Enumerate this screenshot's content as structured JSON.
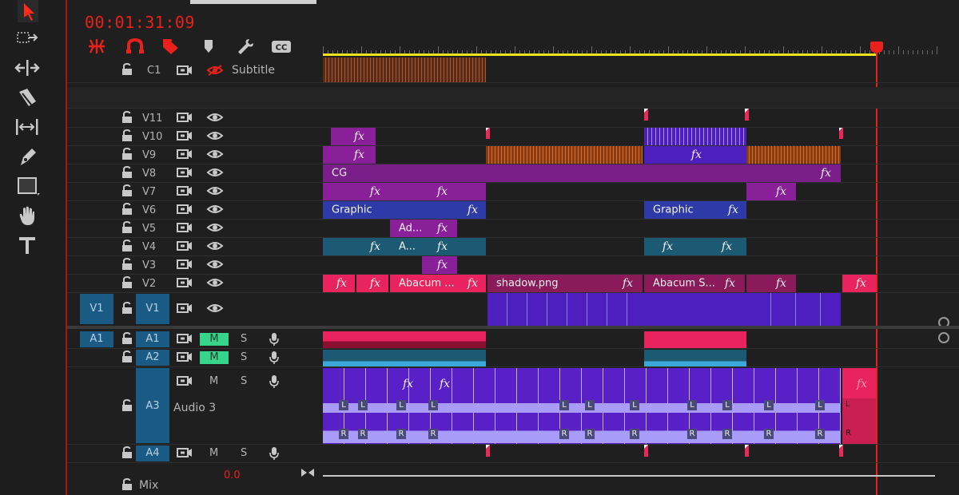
{
  "timecode": "00:01:31:09",
  "tools": [
    "selection-tool",
    "track-select-tool",
    "ripple-edit-tool",
    "razor-tool",
    "slip-tool",
    "pen-tool",
    "rectangle-tool",
    "hand-tool",
    "type-tool"
  ],
  "timeline_controls": [
    "snap-icon",
    "linked-selection-icon",
    "add-marker-icon",
    "marker-icon",
    "settings-wrench-icon",
    "captions-icon"
  ],
  "captions_icon_label": "CC",
  "caption_track": {
    "id": "C1",
    "name": "Subtitle"
  },
  "video_tracks": [
    {
      "id": "V11"
    },
    {
      "id": "V10"
    },
    {
      "id": "V9"
    },
    {
      "id": "V8"
    },
    {
      "id": "V7"
    },
    {
      "id": "V6"
    },
    {
      "id": "V5"
    },
    {
      "id": "V4"
    },
    {
      "id": "V3"
    },
    {
      "id": "V2"
    },
    {
      "id": "V1",
      "source": "V1"
    }
  ],
  "audio_tracks": [
    {
      "id": "A1",
      "source": "A1",
      "mute": "M",
      "solo": "S",
      "mute_on": true
    },
    {
      "id": "A2",
      "mute": "M",
      "solo": "S",
      "mute_on": true
    },
    {
      "id": "A3",
      "name": "Audio 3",
      "mute": "M",
      "solo": "S",
      "mute_on": false
    },
    {
      "id": "A4",
      "mute": "M",
      "solo": "S",
      "mute_on": false
    }
  ],
  "mix": {
    "label": "Mix",
    "value": "0.0"
  },
  "clips": {
    "fx": "fx",
    "cg": "CG",
    "graphic": "Graphic",
    "ad": "Ad...",
    "a": "A...",
    "abacum1": "Abacum ...",
    "shadow": "shadow.png",
    "abacum2": "Abacum S...",
    "ch_l": "L",
    "ch_r": "R"
  },
  "colors": {
    "playhead": "#e8211c",
    "video_magenta": "#8a1f9a",
    "video_blue": "#2e3aa8",
    "video_teal": "#1c5a74",
    "video_pink": "#e8235e",
    "audio_purple": "#5a20c8",
    "mute_green": "#37d58c"
  }
}
